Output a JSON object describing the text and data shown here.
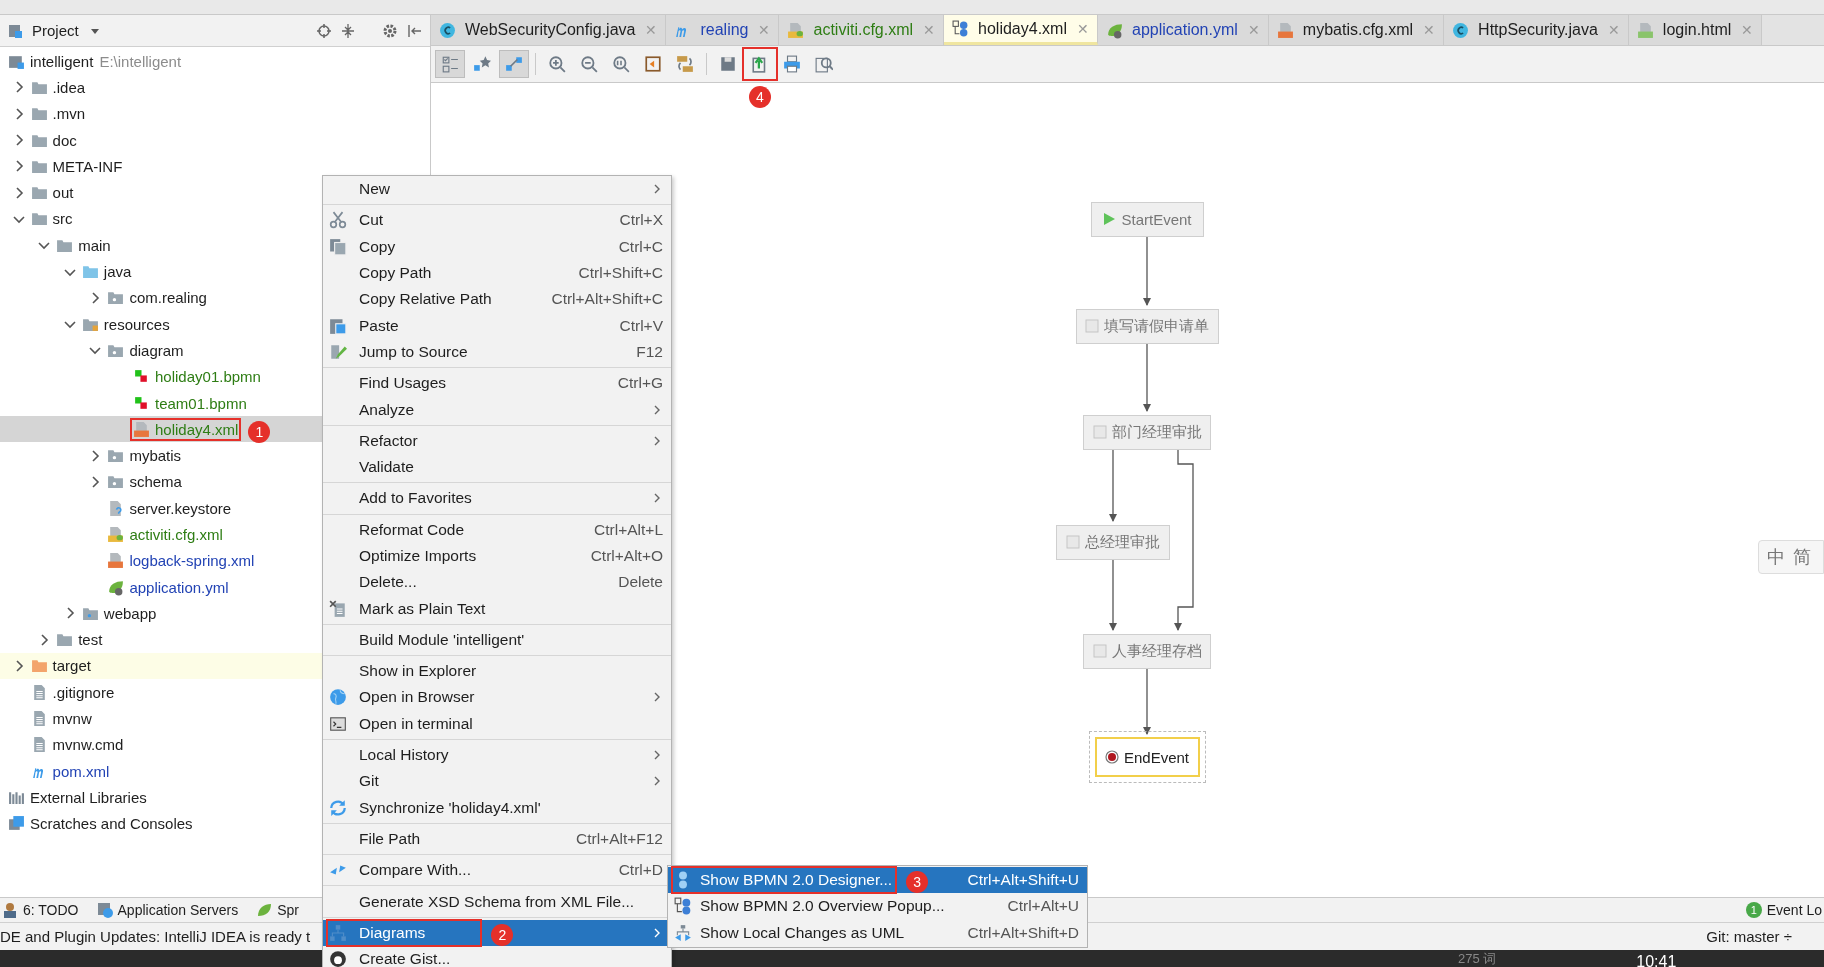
{
  "project_panel": {
    "title": "Project",
    "tree": [
      {
        "label": "intelligent",
        "hint": "E:\\intelligent",
        "kind": "module",
        "selected": false,
        "children": [
          {
            "label": ".idea",
            "kind": "folder",
            "expanded": false,
            "selected": false
          },
          {
            "label": ".mvn",
            "kind": "folder",
            "expanded": false,
            "selected": false
          },
          {
            "label": "doc",
            "kind": "folder",
            "expanded": false,
            "selected": false
          },
          {
            "label": "META-INF",
            "kind": "folder",
            "expanded": false,
            "selected": false
          },
          {
            "label": "out",
            "kind": "folder",
            "expanded": false,
            "selected": false
          },
          {
            "label": "src",
            "kind": "folder",
            "expanded": true,
            "selected": false,
            "children": [
              {
                "label": "main",
                "kind": "folder",
                "expanded": true,
                "selected": false,
                "children": [
                  {
                    "label": "java",
                    "kind": "source",
                    "expanded": true,
                    "selected": false,
                    "children": [
                      {
                        "label": "com.realing",
                        "kind": "package",
                        "expanded": false,
                        "selected": false
                      }
                    ]
                  },
                  {
                    "label": "resources",
                    "kind": "resources",
                    "expanded": true,
                    "selected": false,
                    "children": [
                      {
                        "label": "diagram",
                        "kind": "package",
                        "expanded": true,
                        "selected": false,
                        "children": [
                          {
                            "label": "holiday01.bpmn",
                            "kind": "bpmn",
                            "color": "#2e7d14",
                            "selected": false
                          },
                          {
                            "label": "team01.bpmn",
                            "kind": "bpmn",
                            "color": "#2e7d14",
                            "selected": false
                          },
                          {
                            "label": "holiday4.xml",
                            "kind": "xml",
                            "color": "#2e7d14",
                            "selected": true,
                            "callout": "1"
                          }
                        ]
                      },
                      {
                        "label": "mybatis",
                        "kind": "package",
                        "expanded": false,
                        "selected": false
                      },
                      {
                        "label": "schema",
                        "kind": "package",
                        "expanded": false,
                        "selected": false
                      },
                      {
                        "label": "server.keystore",
                        "kind": "keystore",
                        "selected": false
                      },
                      {
                        "label": "activiti.cfg.xml",
                        "kind": "spring-xml",
                        "color": "#2e7d14",
                        "selected": false
                      },
                      {
                        "label": "logback-spring.xml",
                        "kind": "xml",
                        "color": "#2243b4",
                        "selected": false
                      },
                      {
                        "label": "application.yml",
                        "kind": "yml",
                        "color": "#2243b4",
                        "selected": false
                      }
                    ]
                  },
                  {
                    "label": "webapp",
                    "kind": "webapp",
                    "expanded": false,
                    "selected": false
                  }
                ]
              },
              {
                "label": "test",
                "kind": "folder",
                "expanded": false,
                "selected": false
              }
            ]
          },
          {
            "label": "target",
            "kind": "excluded",
            "expanded": false,
            "selected": false
          },
          {
            "label": ".gitignore",
            "kind": "text",
            "selected": false
          },
          {
            "label": "mvnw",
            "kind": "text",
            "selected": false
          },
          {
            "label": "mvnw.cmd",
            "kind": "text",
            "selected": false
          },
          {
            "label": "pom.xml",
            "kind": "maven",
            "color": "#2243b4",
            "selected": false
          }
        ]
      },
      {
        "label": "External Libraries",
        "kind": "libraries",
        "selected": false
      },
      {
        "label": "Scratches and Consoles",
        "kind": "scratches",
        "selected": false
      }
    ]
  },
  "editor_tabs": [
    {
      "label": "WebSecurityConfig.java",
      "kind": "class",
      "selected": false,
      "close": "✕"
    },
    {
      "label": "realing",
      "kind": "maven",
      "color": "#2243b4",
      "selected": false,
      "close": "✕"
    },
    {
      "label": "activiti.cfg.xml",
      "kind": "spring-xml",
      "color": "#2e7d14",
      "selected": false,
      "close": "✕"
    },
    {
      "label": "holiday4.xml",
      "kind": "diagram",
      "selected": true,
      "close": "✕"
    },
    {
      "label": "application.yml",
      "kind": "yml",
      "color": "#2243b4",
      "selected": false,
      "close": "✕"
    },
    {
      "label": "mybatis.cfg.xml",
      "kind": "xml",
      "selected": false,
      "close": "✕"
    },
    {
      "label": "HttpSecurity.java",
      "kind": "class",
      "selected": false,
      "close": "✕"
    },
    {
      "label": "login.html",
      "kind": "html",
      "selected": false,
      "close": "✕"
    }
  ],
  "diagram_toolbar": [
    {
      "kind": "properties",
      "pressed": true
    },
    {
      "kind": "favorite",
      "pressed": false
    },
    {
      "kind": "select",
      "pressed": true
    },
    {
      "kind": "zoom-in",
      "pressed": false
    },
    {
      "kind": "zoom-out",
      "pressed": false
    },
    {
      "kind": "actual-size",
      "pressed": false
    },
    {
      "kind": "fit",
      "pressed": false
    },
    {
      "kind": "layout",
      "pressed": false
    },
    {
      "kind": "save",
      "pressed": false
    },
    {
      "kind": "export",
      "pressed": false,
      "callout": "4"
    },
    {
      "kind": "print",
      "pressed": false
    },
    {
      "kind": "preview",
      "pressed": false
    }
  ],
  "diagram": {
    "nodes": [
      {
        "kind": "start",
        "label": "StartEvent",
        "selected": false
      },
      {
        "kind": "task",
        "label": "填写请假申请单",
        "selected": false
      },
      {
        "kind": "task",
        "label": "部门经理审批",
        "selected": false
      },
      {
        "kind": "task",
        "label": "总经理审批",
        "selected": false
      },
      {
        "kind": "task",
        "label": "人事经理存档",
        "selected": false
      },
      {
        "kind": "end",
        "label": "EndEvent",
        "selected": true
      }
    ]
  },
  "ime_bar": {
    "mode": "中",
    "script": "简"
  },
  "context_menu": {
    "groups": [
      [
        {
          "label": "New",
          "submenu": true,
          "selected": false
        }
      ],
      [
        {
          "label": "Cut",
          "shortcut": "Ctrl+X",
          "kind": "cut",
          "selected": false
        },
        {
          "label": "Copy",
          "shortcut": "Ctrl+C",
          "kind": "copy",
          "selected": false
        },
        {
          "label": "Copy Path",
          "shortcut": "Ctrl+Shift+C",
          "selected": false
        },
        {
          "label": "Copy Relative Path",
          "shortcut": "Ctrl+Alt+Shift+C",
          "selected": false
        },
        {
          "label": "Paste",
          "shortcut": "Ctrl+V",
          "kind": "paste",
          "selected": false
        },
        {
          "label": "Jump to Source",
          "shortcut": "F12",
          "kind": "edit",
          "selected": false
        }
      ],
      [
        {
          "label": "Find Usages",
          "shortcut": "Ctrl+G",
          "selected": false
        },
        {
          "label": "Analyze",
          "submenu": true,
          "selected": false
        }
      ],
      [
        {
          "label": "Refactor",
          "submenu": true,
          "selected": false
        },
        {
          "label": "Validate",
          "selected": false
        }
      ],
      [
        {
          "label": "Add to Favorites",
          "submenu": true,
          "selected": false
        }
      ],
      [
        {
          "label": "Reformat Code",
          "shortcut": "Ctrl+Alt+L",
          "selected": false
        },
        {
          "label": "Optimize Imports",
          "shortcut": "Ctrl+Alt+O",
          "selected": false
        },
        {
          "label": "Delete...",
          "shortcut": "Delete",
          "selected": false
        },
        {
          "label": "Mark as Plain Text",
          "kind": "plain",
          "selected": false
        }
      ],
      [
        {
          "label": "Build Module 'intelligent'",
          "selected": false
        }
      ],
      [
        {
          "label": "Show in Explorer",
          "selected": false
        },
        {
          "label": "Open in Browser",
          "submenu": true,
          "kind": "globe",
          "selected": false
        },
        {
          "label": "Open in terminal",
          "kind": "terminal",
          "selected": false
        }
      ],
      [
        {
          "label": "Local History",
          "submenu": true,
          "selected": false
        },
        {
          "label": "Git",
          "submenu": true,
          "selected": false
        },
        {
          "label": "Synchronize 'holiday4.xml'",
          "kind": "sync",
          "selected": false
        }
      ],
      [
        {
          "label": "File Path",
          "shortcut": "Ctrl+Alt+F12",
          "selected": false
        }
      ],
      [
        {
          "label": "Compare With...",
          "shortcut": "Ctrl+D",
          "kind": "compare",
          "selected": false
        }
      ],
      [
        {
          "label": "Generate XSD Schema from XML File...",
          "selected": false
        }
      ],
      [
        {
          "label": "Diagrams",
          "submenu": true,
          "kind": "diagram",
          "selected": true,
          "callout": "2"
        },
        {
          "label": "Create Gist...",
          "kind": "gist",
          "selected": false
        }
      ]
    ]
  },
  "diagrams_submenu": [
    {
      "label": "Show BPMN 2.0 Designer...",
      "shortcut": "Ctrl+Alt+Shift+U",
      "kind": "bpmn",
      "selected": true,
      "callout": "3"
    },
    {
      "label": "Show BPMN 2.0 Overview Popup...",
      "shortcut": "Ctrl+Alt+U",
      "kind": "overview",
      "selected": false
    },
    {
      "label": "Show Local Changes as UML",
      "shortcut": "Ctrl+Alt+Shift+D",
      "kind": "uml",
      "selected": false
    }
  ],
  "tool_window_bar": {
    "left": [
      {
        "label": "6: TODO",
        "kind": "todo"
      },
      {
        "label": "Application Servers",
        "kind": "servers"
      },
      {
        "label": "Spr",
        "kind": "spring"
      }
    ],
    "right": [
      {
        "label": "Event Lo",
        "badge": "1"
      }
    ]
  },
  "status_bar": {
    "message": "DE and Plugin Updates: IntelliJ IDEA is ready t",
    "branch": "Git: master ÷"
  },
  "taskbar": {
    "word_count": "275 词",
    "time": "10:41"
  }
}
